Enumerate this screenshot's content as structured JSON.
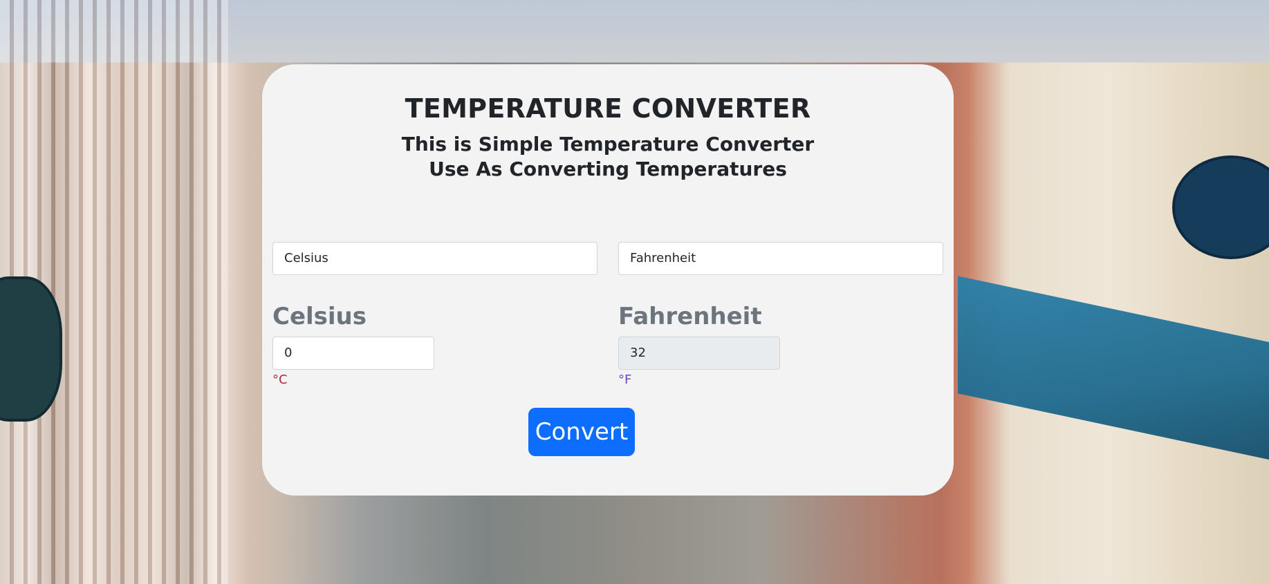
{
  "header": {
    "title": "TEMPERATURE CONVERTER",
    "subtitle_line1": "This is Simple Temperature Converter",
    "subtitle_line2": "Use As Converting Temperatures"
  },
  "from_unit_select": {
    "selected": "Celsius"
  },
  "to_unit_select": {
    "selected": "Fahrenheit"
  },
  "input_panel": {
    "label": "Celsius",
    "value": "0",
    "unit": "°C"
  },
  "output_panel": {
    "label": "Fahrenheit",
    "value": "32",
    "unit": "°F"
  },
  "convert_button": {
    "label": "Convert"
  },
  "colors": {
    "primary": "#0d6efd",
    "card_bg": "#f3f3f3",
    "celsius_unit": "#b02a37",
    "fahrenheit_unit": "#6f42c1"
  }
}
